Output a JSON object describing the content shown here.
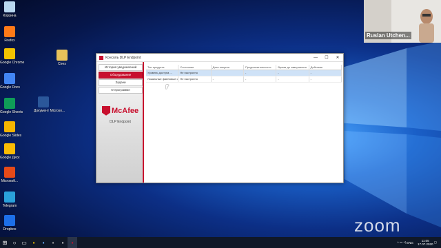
{
  "desktop": {
    "icons": [
      {
        "label": "Корзина",
        "color": "#b9d7ef",
        "glyph": "recycle-bin-icon"
      },
      {
        "label": "Firefox",
        "color": "#ff7a18",
        "glyph": "firefox-icon"
      },
      {
        "label": "Google Chrome",
        "color": "#f2c200",
        "glyph": "chrome-icon"
      },
      {
        "label": "Google Docs",
        "color": "#4285f4",
        "glyph": "docs-icon"
      },
      {
        "label": "Google Sheets",
        "color": "#0f9d58",
        "glyph": "sheets-icon"
      },
      {
        "label": "Google Slides",
        "color": "#f4b400",
        "glyph": "slides-icon"
      },
      {
        "label": "Google Диск",
        "color": "#fbbc04",
        "glyph": "drive-icon"
      },
      {
        "label": "Microsoft...",
        "color": "#e64a19",
        "glyph": "office-icon"
      },
      {
        "label": "Telegram",
        "color": "#2aa1da",
        "glyph": "telegram-icon"
      },
      {
        "label": "Dropbox",
        "color": "#1d6fe8",
        "glyph": "dropbox-icon"
      }
    ],
    "extra_icons": [
      {
        "label": "Cees",
        "color": "#e8c25a",
        "glyph": "folder-icon"
      },
      {
        "label": "Документ Microso...",
        "color": "#2b579a",
        "glyph": "word-icon"
      }
    ]
  },
  "video": {
    "name": "Ruslan Utchen..."
  },
  "window": {
    "title": "Консоль DLP Endpoint",
    "controls": {
      "minimize": "—",
      "maximize": "☐",
      "close": "✕"
    },
    "nav": [
      {
        "label": "История уведомлений",
        "active": false
      },
      {
        "label": "Оборудование",
        "active": true
      },
      {
        "label": "Задачи",
        "active": false
      },
      {
        "label": "О программе",
        "active": false
      }
    ],
    "logo": {
      "brand": "McAfee",
      "sub": "DLP Endpoint"
    },
    "table": {
      "columns": [
        "Тип продукта",
        "Состояние",
        "Дата запуска",
        "Продолжительность",
        "Время до завершения",
        "Действие"
      ],
      "rows": [
        [
          "Уровень доступа ...",
          "Не настроено",
          "",
          "-",
          "-",
          "-"
        ],
        [
          "Локальные файловые с...",
          "Не настроено",
          "-",
          "-",
          "-",
          "-"
        ]
      ]
    }
  },
  "zoom_logo": "zoom",
  "taskbar": {
    "start": "⊞",
    "tray_lang": "ENG",
    "time": "11:05",
    "date": "17.07.2020"
  }
}
